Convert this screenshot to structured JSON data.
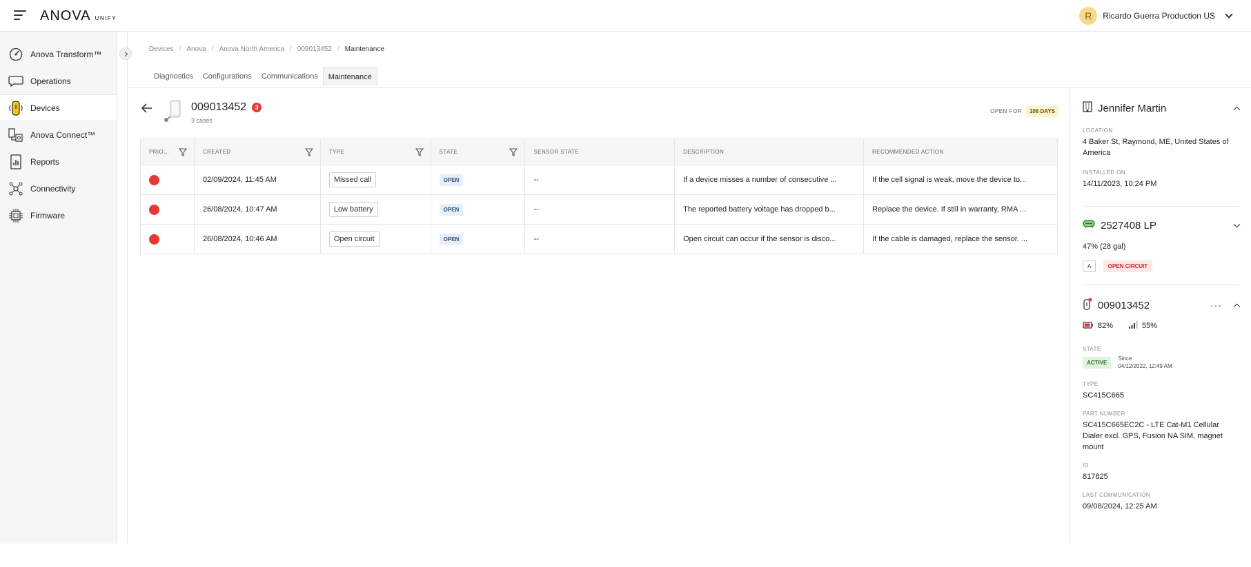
{
  "app": {
    "logo": "ANOVA",
    "logo_sub": "UNIFY"
  },
  "user": {
    "initial": "R",
    "name": "Ricardo Guerra Production US"
  },
  "sidebar": {
    "items": [
      {
        "label": "Anova Transform™",
        "icon": "gauge-icon"
      },
      {
        "label": "Operations",
        "icon": "chat-bubble-icon"
      },
      {
        "label": "Devices",
        "icon": "device-icon"
      },
      {
        "label": "Anova Connect™",
        "icon": "network-device-icon"
      },
      {
        "label": "Reports",
        "icon": "report-icon"
      },
      {
        "label": "Connectivity",
        "icon": "connectivity-icon"
      },
      {
        "label": "Firmware",
        "icon": "chip-icon"
      }
    ]
  },
  "breadcrumb": [
    "Devices",
    "Anova",
    "Anova North America",
    "009013452",
    "Maintenance"
  ],
  "tabs": [
    "Diagnostics",
    "Configurations",
    "Communications",
    "Maintenance"
  ],
  "device": {
    "id": "009013452",
    "case_count": "3",
    "cases_text": "3 cases",
    "open_for_label": "OPEN FOR",
    "open_for_value": "106 DAYS"
  },
  "table": {
    "headers": [
      "PRIO...",
      "CREATED",
      "TYPE",
      "STATE",
      "SENSOR STATE",
      "DESCRIPTION",
      "RECOMMENDED ACTION"
    ],
    "rows": [
      {
        "created": "02/09/2024, 11:45 AM",
        "type": "Missed call",
        "state": "OPEN",
        "sensor_state": "--",
        "description": "If a device misses a number of consecutive ...",
        "action": "If the cell signal is weak, move the device to..."
      },
      {
        "created": "26/08/2024, 10:47 AM",
        "type": "Low battery",
        "state": "OPEN",
        "sensor_state": "--",
        "description": "The reported battery voltage has dropped b...",
        "action": "Replace the device. If still in warranty, RMA ..."
      },
      {
        "created": "26/08/2024, 10:46 AM",
        "type": "Open circuit",
        "state": "OPEN",
        "sensor_state": "--",
        "description": "Open circuit can occur if the sensor is disco...",
        "action": "If the cable is damaged, replace the sensor. ..."
      }
    ]
  },
  "panel": {
    "customer": {
      "name": "Jennifer Martin",
      "location_label": "LOCATION",
      "location": "4 Baker St, Raymond, ME, United States of America",
      "installed_label": "INSTALLED ON",
      "installed": "14/11/2023, 10:24 PM"
    },
    "tank": {
      "name": "2527408 LP",
      "level": "47% (28 gal)",
      "chip_a": "A",
      "status": "OPEN CIRCUIT"
    },
    "device": {
      "name": "009013452",
      "battery": "82%",
      "signal": "55%",
      "state_label": "STATE",
      "state": "ACTIVE",
      "since_label": "Since",
      "since": "04/12/2022, 12:49 AM",
      "type_label": "TYPE",
      "type": "SC415C665",
      "part_label": "PART NUMBER",
      "part": "SC415C665EC2C - LTE Cat-M1 Cellular Dialer excl. GPS, Fusion NA SIM, magnet mount",
      "id_label": "ID",
      "id": "817825",
      "last_comm_label": "LAST COMMUNICATION",
      "last_comm": "09/08/2024, 12:25 AM"
    }
  },
  "colors": {
    "priority_high": "#e53935",
    "accent_yellow": "#fdf3cf"
  }
}
